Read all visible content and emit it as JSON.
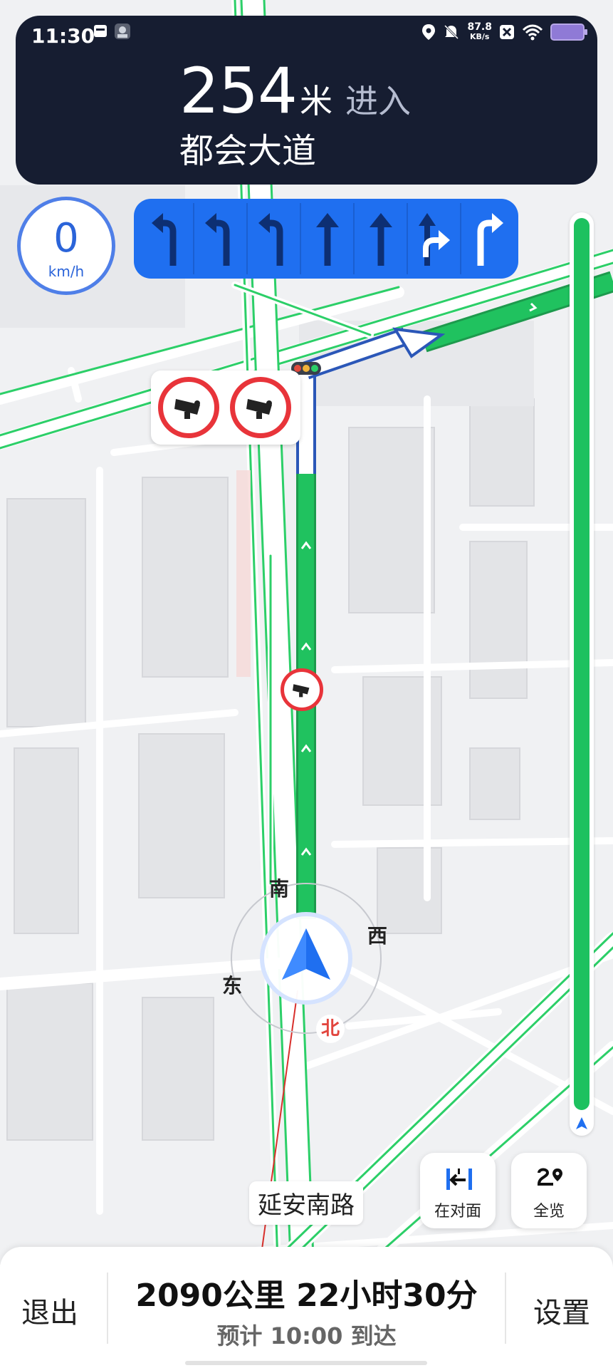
{
  "status_bar": {
    "time": "11:30",
    "net_speed_value": "87.8",
    "net_speed_unit": "KB/s",
    "icons": [
      "calendar-icon",
      "app-avatar-icon",
      "location-icon",
      "mute-icon",
      "close-box-icon",
      "wifi-icon",
      "battery-icon"
    ]
  },
  "guidance": {
    "distance": "254",
    "unit": "米",
    "action": "进入",
    "road": "都会大道"
  },
  "speed": {
    "value": "0",
    "unit": "km/h"
  },
  "lanes": [
    "left",
    "left",
    "left",
    "straight",
    "straight",
    "straight-right",
    "right"
  ],
  "compass": {
    "south": "南",
    "east": "东",
    "west": "西",
    "north": "北"
  },
  "street_label": "延安南路",
  "map_buttons": {
    "opposite_label": "在对面",
    "overview_label": "全览"
  },
  "bottom": {
    "exit": "退出",
    "summary": "2090公里 22小时30分",
    "arrival": "预计 10:00 到达",
    "settings": "设置"
  },
  "colors": {
    "panel": "#161d31",
    "lane_bg": "#1f6ff0",
    "route": "#1dc15f",
    "camera": "#e8343a"
  }
}
